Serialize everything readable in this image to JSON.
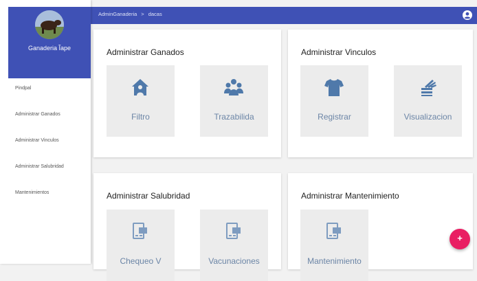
{
  "sidebar": {
    "farm_name": "Ganaderia Ĩape",
    "items": [
      {
        "label": "Pindpal"
      },
      {
        "label": "Administrar Ganados"
      },
      {
        "label": "Administrar Vinculos"
      },
      {
        "label": "Administrar Salubridad"
      },
      {
        "label": "Mantenimientos"
      }
    ]
  },
  "header": {
    "breadcrumb": [
      "AdminGanaderia",
      ">",
      "dacas"
    ],
    "account_icon": "account-circle-icon"
  },
  "cards": [
    {
      "title": "Administrar Ganados",
      "tiles": [
        {
          "label": "Filtro",
          "icon": "home-person-icon"
        },
        {
          "label": "Trazabilida",
          "icon": "group-icon"
        }
      ]
    },
    {
      "title": "Administrar Vinculos",
      "tiles": [
        {
          "label": "Registrar",
          "icon": "tshirt-icon"
        },
        {
          "label": "Visualizacion",
          "icon": "clipboard-list-icon"
        }
      ]
    },
    {
      "title": "Administrar Salubridad",
      "tiles": [
        {
          "label": "Chequeo V",
          "icon": "document-icon"
        },
        {
          "label": "Vacunaciones",
          "icon": "document-icon"
        }
      ]
    },
    {
      "title": "Administrar Mantenimiento",
      "tiles": [
        {
          "label": "Mantenimiento",
          "icon": "document-icon"
        }
      ]
    }
  ],
  "fab": {
    "label": "+",
    "icon": "plus-icon"
  },
  "colors": {
    "primary": "#3f51b5",
    "accent": "#e91e63",
    "icon": "#4f79aa",
    "tile_bg": "#ececec"
  }
}
